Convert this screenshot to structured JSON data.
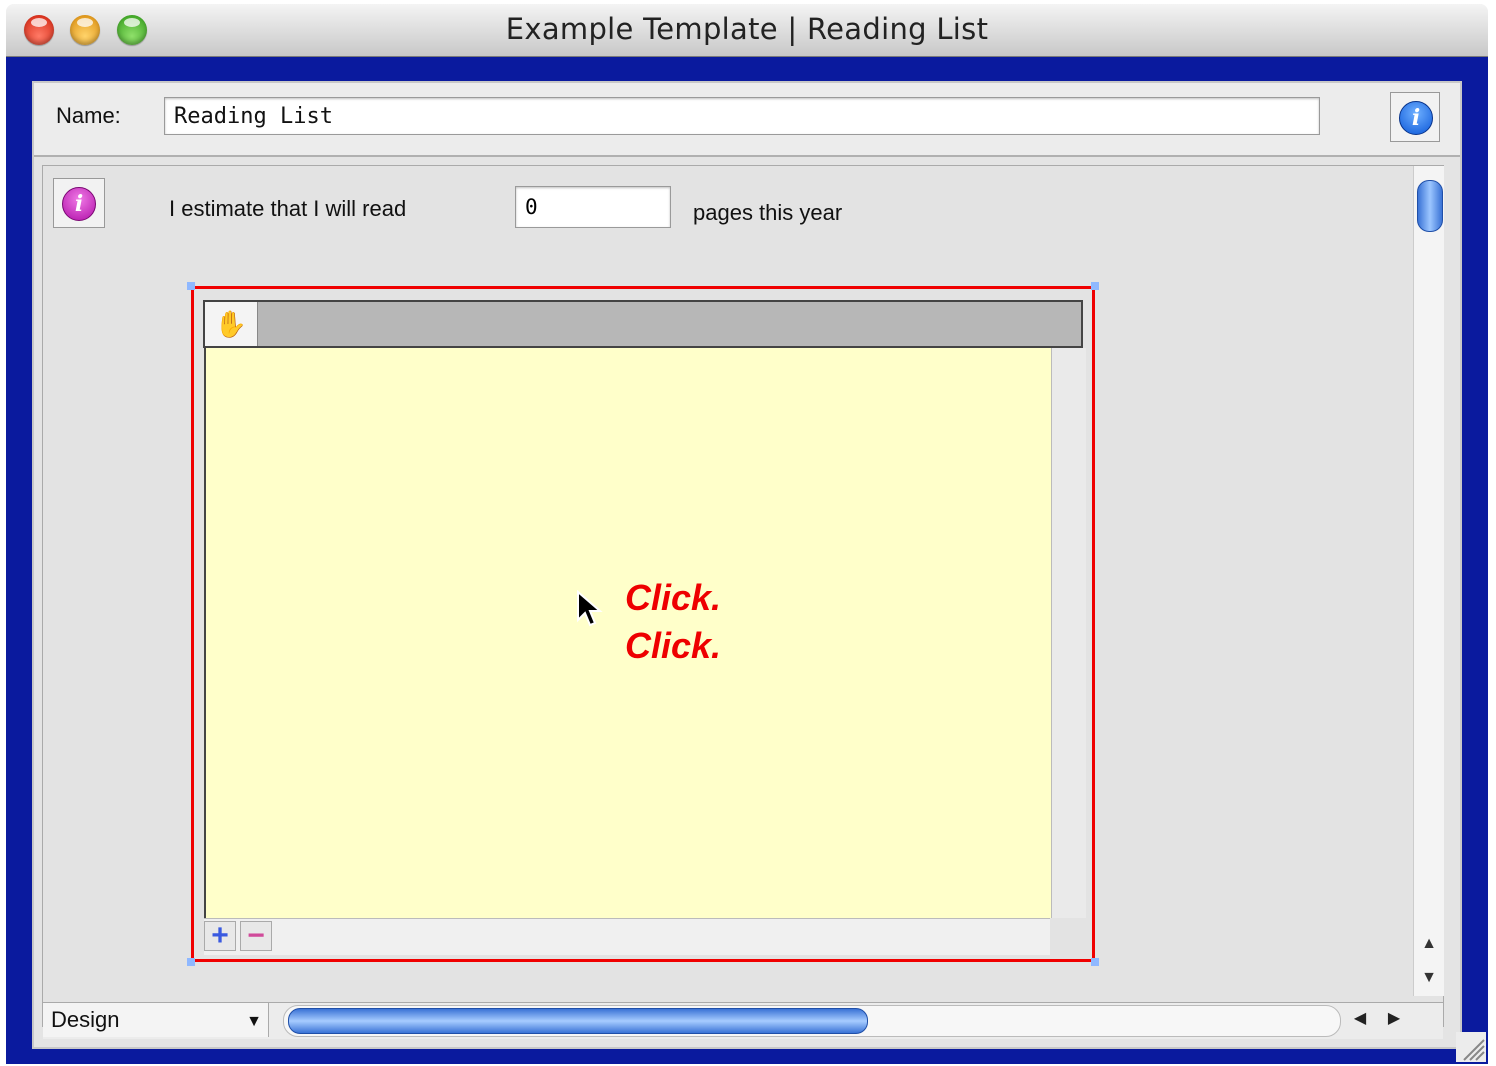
{
  "window": {
    "title": "Example Template | Reading List"
  },
  "header": {
    "name_label": "Name:",
    "name_value": "Reading List"
  },
  "estimate": {
    "prefix": "I estimate that I will read",
    "pages_value": "0",
    "suffix": "pages this year"
  },
  "portal": {
    "click_line1": "Click.",
    "click_line2": "Click.",
    "add_label": "+",
    "remove_label": "−"
  },
  "footer": {
    "mode": "Design"
  },
  "colors": {
    "frame_blue": "#0a1a9e",
    "portal_fill": "#ffffca",
    "selection_outline": "#f00000",
    "click_text": "#ee0000",
    "info_blue": "#1a6ff0",
    "info_magenta": "#d018c8"
  },
  "icons": {
    "close": "close-icon",
    "minimize": "minimize-icon",
    "zoom": "zoom-icon",
    "info": "info-icon",
    "hand": "hand-icon",
    "cursor": "pointer-cursor-icon"
  }
}
